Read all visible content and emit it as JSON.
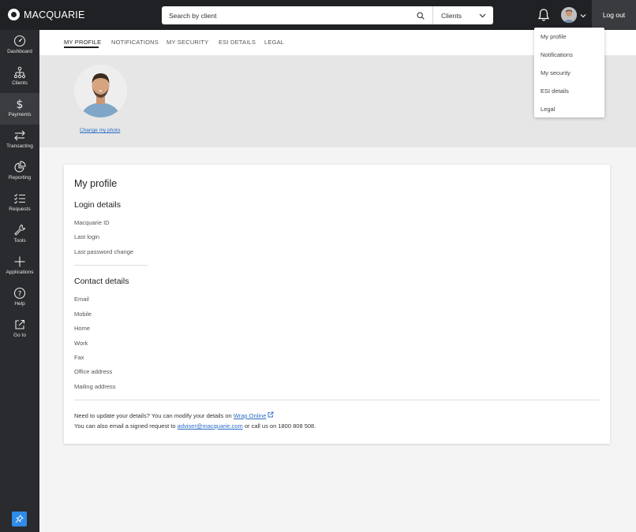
{
  "brand": {
    "name": "MACQUARIE"
  },
  "search": {
    "placeholder": "Search by client",
    "select_value": "Clients"
  },
  "header": {
    "logout_label": "Log out"
  },
  "sidebar": {
    "items": [
      {
        "label": "Dashboard",
        "icon": "speedometer-icon"
      },
      {
        "label": "Clients",
        "icon": "hierarchy-icon"
      },
      {
        "label": "Payments",
        "icon": "dollar-icon"
      },
      {
        "label": "Transacting",
        "icon": "swap-arrows-icon"
      },
      {
        "label": "Reporting",
        "icon": "pie-chart-icon"
      },
      {
        "label": "Requests",
        "icon": "checklist-icon"
      },
      {
        "label": "Tools",
        "icon": "wrench-icon"
      },
      {
        "label": "Applications",
        "icon": "plus-icon"
      },
      {
        "label": "Help",
        "icon": "question-icon"
      },
      {
        "label": "Go to",
        "icon": "external-link-icon"
      }
    ],
    "active_index": 2
  },
  "tabs": [
    {
      "label": "MY PROFILE"
    },
    {
      "label": "NOTIFICATIONS"
    },
    {
      "label": "MY SECURITY"
    },
    {
      "label": "ESI DETAILS"
    },
    {
      "label": "LEGAL"
    }
  ],
  "photo": {
    "change_label": "Change my photo"
  },
  "profile": {
    "title": "My profile",
    "login_title": "Login details",
    "login_fields": [
      "Macquarie ID",
      "Last login",
      "Last password change"
    ],
    "contact_title": "Contact details",
    "contact_fields": [
      "Email",
      "Mobile",
      "Home",
      "Work",
      "Fax",
      "Office address",
      "Mailing address"
    ],
    "note1_prefix": "Need to update your details? You can modify your details on",
    "note1_link": "Wrap Online",
    "note2_prefix": "You can also email a signed request to",
    "note2_link": "adviser@macquarie.com",
    "note2_suffix": "or call us on 1800 808 508."
  },
  "user_menu": {
    "items": [
      "My profile",
      "Notifications",
      "My security",
      "ESI details",
      "Legal"
    ]
  },
  "colors": {
    "topbar": "#202124",
    "sidebar": "#2a2b2e",
    "link": "#2b6cc4",
    "pin": "#2f8ce8"
  }
}
